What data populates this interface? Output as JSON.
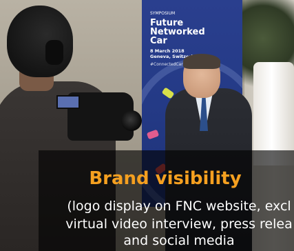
{
  "banner": {
    "symposium": "SYMPOSIUM",
    "title_lines": [
      "Future",
      "Networked",
      "Car"
    ],
    "date": "8 March 2018",
    "location": "Geneva, Switzerla...",
    "hashtag": "#ConnectedCar"
  },
  "caption": {
    "title": "Brand visibility",
    "lines": [
      "(logo display on FNC website, excl",
      "virtual video interview, press relea",
      "and social media"
    ]
  },
  "colors": {
    "caption_title": "#f5a020",
    "caption_text": "#ffffff",
    "banner_blue": "#243a86"
  }
}
